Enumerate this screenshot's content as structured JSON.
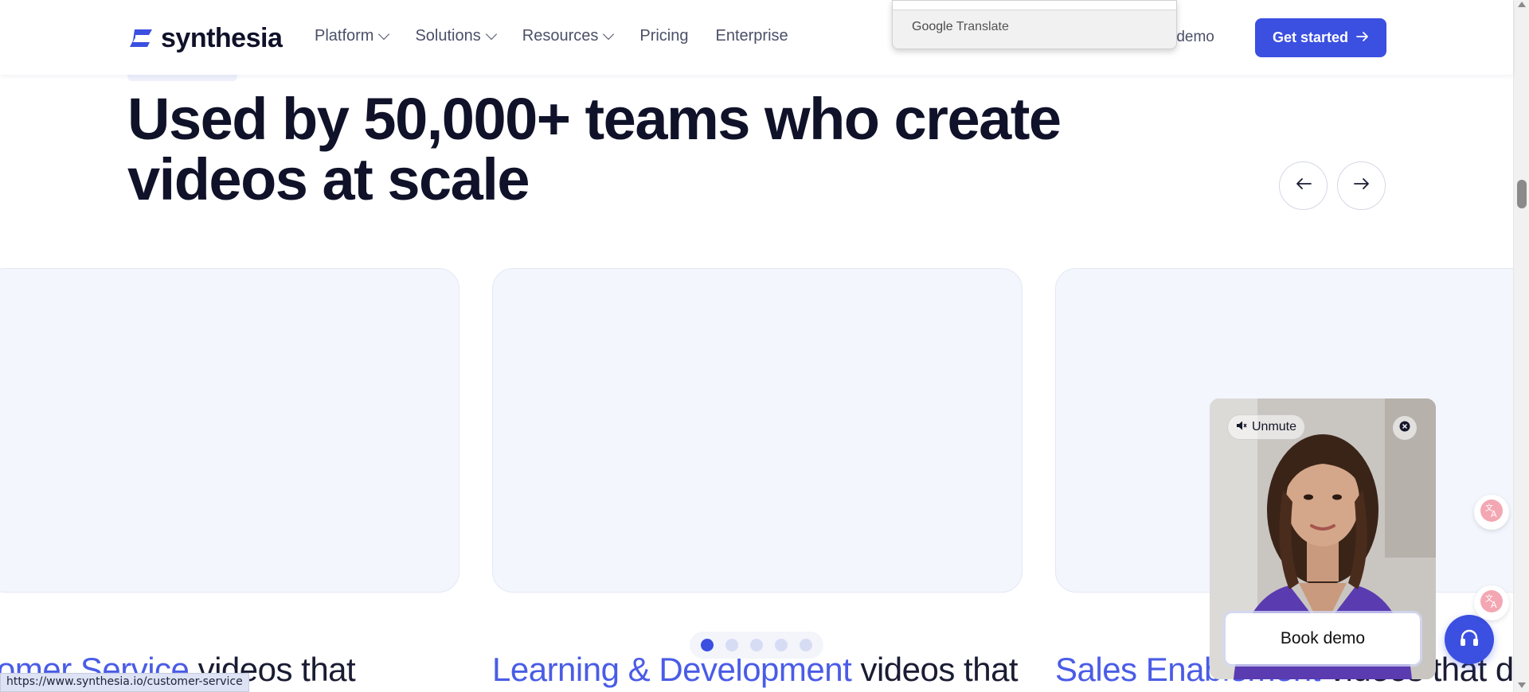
{
  "header": {
    "logo_text": "synthesia",
    "nav": [
      {
        "label": "Platform",
        "has_dropdown": true
      },
      {
        "label": "Solutions",
        "has_dropdown": true
      },
      {
        "label": "Resources",
        "has_dropdown": true
      },
      {
        "label": "Pricing",
        "has_dropdown": false
      },
      {
        "label": "Enterprise",
        "has_dropdown": false
      }
    ],
    "book_demo_label": "ok demo",
    "get_started_label": "Get started"
  },
  "google_translate": {
    "brand": "Google",
    "label": "Translate"
  },
  "hero": {
    "headline_line1": "Used by 50,000+ teams who create",
    "headline_line2": "videos at scale"
  },
  "carousel": {
    "captions": [
      {
        "highlight": "omer Service",
        "rest": " videos that"
      },
      {
        "highlight": "Learning & Development",
        "rest": " videos that"
      },
      {
        "highlight": "Sales Enablement",
        "rest": " videos that dr"
      }
    ],
    "dots_count": 5,
    "active_dot": 0
  },
  "video_widget": {
    "unmute_label": "Unmute",
    "book_demo_label": "Book demo"
  },
  "status_bar": {
    "url": "https://www.synthesia.io/customer-service"
  },
  "colors": {
    "brand": "#3b4fe0",
    "highlight": "#4a5ce6",
    "text_dark": "#10122a"
  },
  "icons": {
    "arrow_left": "arrow-left-icon",
    "arrow_right": "arrow-right-icon",
    "speaker_muted": "speaker-muted-icon",
    "close": "close-icon",
    "headset": "headset-icon",
    "translate": "translate-icon"
  }
}
